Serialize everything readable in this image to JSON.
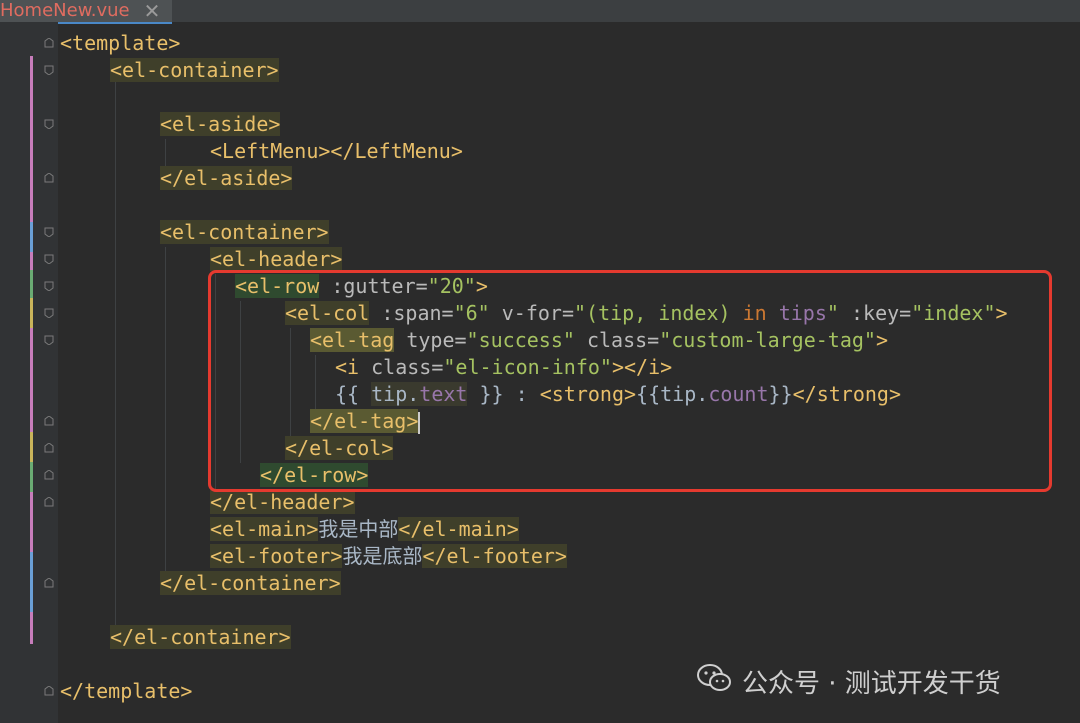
{
  "tab": {
    "label": "HomeNew.vue",
    "close": "✕"
  },
  "colors": {
    "background": "#2b2b2b",
    "tag": "#e8bf6a",
    "attr_value": "#a5c261",
    "keyword": "#cc7832",
    "property": "#9876aa",
    "highlight_box": "#e53a2f"
  },
  "code": {
    "l1": {
      "open": "<template>"
    },
    "l2": {
      "open": "<el-container>"
    },
    "l4": {
      "open": "<el-aside>"
    },
    "l5": {
      "a": "<LeftMenu>",
      "b": "</LeftMenu>"
    },
    "l6": {
      "close": "</el-aside>"
    },
    "l8": {
      "open": "<el-container>"
    },
    "l9": {
      "open": "<el-header>"
    },
    "l10": {
      "tag": "<el-row",
      "attr": " :gutter=",
      "val": "\"20\"",
      "end": ">"
    },
    "l11": {
      "tag": "<el-col",
      "attr1": " :span=",
      "val1": "\"6\"",
      "attr2": " v-for=",
      "q1": "\"(tip, index) ",
      "in": "in",
      "tips": " tips",
      "q2": "\"",
      "attr3": " :key=",
      "val3": "\"index\"",
      "end": ">"
    },
    "l12": {
      "tag": "<el-tag",
      "attr1": " type=",
      "val1": "\"success\"",
      "attr2": " class=",
      "val2": "\"custom-large-tag\"",
      "end": ">"
    },
    "l13": {
      "tag": "<i",
      "attr": " class=",
      "val": "\"el-icon-info\"",
      "end": "></i>"
    },
    "l14": {
      "m1": "{{ ",
      "tip": "tip",
      "dot": ".",
      "text": "text",
      "m2": " }}",
      "colon": " : ",
      "s1": "<strong>",
      "m3": "{{",
      "tip2": "tip",
      "dot2": ".",
      "count": "count",
      "m4": "}}",
      "s2": "</strong>"
    },
    "l15": {
      "close": "</el-tag",
      "gt": ">"
    },
    "l16": {
      "close": "</el-col>"
    },
    "l17": {
      "close": "</el-row>"
    },
    "l18": {
      "close": "</el-header>"
    },
    "l19": {
      "open": "<el-main>",
      "text": "我是中部",
      "close": "</el-main>"
    },
    "l20": {
      "open": "<el-footer>",
      "text": "我是底部",
      "close": "</el-footer>"
    },
    "l21": {
      "close": "</el-container>"
    },
    "l23": {
      "close": "</el-container>"
    },
    "l25": {
      "close": "</template>"
    }
  },
  "watermark": {
    "text": "公众号 · 测试开发干货",
    "icon": "wechat-icon"
  }
}
